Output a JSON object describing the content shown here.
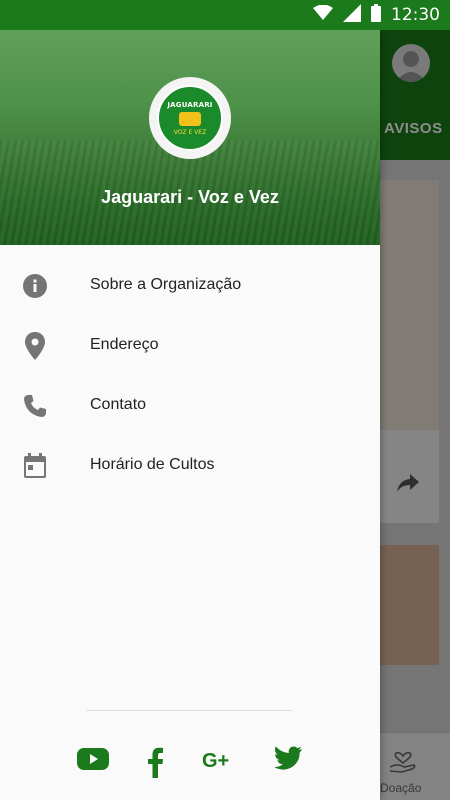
{
  "status_bar": {
    "time": "12:30"
  },
  "background_app": {
    "tab_label": "AVISOS",
    "bottom_nav_label": "Doação"
  },
  "drawer": {
    "logo_text_top": "JAGUARARI",
    "logo_text_bottom": "VOZ E VEZ",
    "title": "Jaguarari - Voz e Vez",
    "menu": [
      {
        "label": "Sobre a Organização",
        "icon": "info-icon"
      },
      {
        "label": "Endereço",
        "icon": "location-pin-icon"
      },
      {
        "label": "Contato",
        "icon": "phone-icon"
      },
      {
        "label": "Horário de Cultos",
        "icon": "calendar-icon"
      }
    ],
    "social": [
      "youtube-icon",
      "facebook-icon",
      "google-plus-icon",
      "twitter-icon"
    ]
  },
  "colors": {
    "primary": "#1b7a1b",
    "icon_gray": "#757575"
  }
}
